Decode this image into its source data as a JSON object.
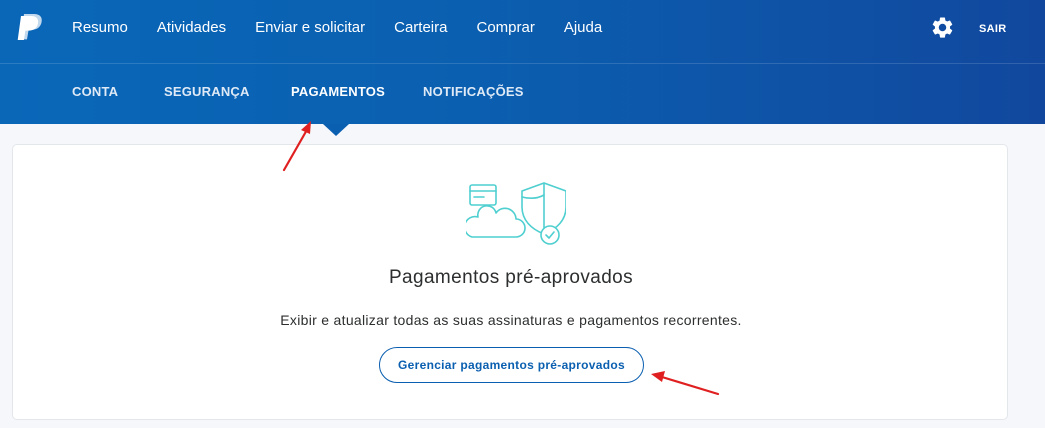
{
  "colors": {
    "header_start": "#0a67b8",
    "header_end": "#11489e",
    "accent": "#0b5fb0",
    "illustration": "#4fcfd0",
    "annotation": "#e02020"
  },
  "topnav": {
    "logo": "paypal-logo-icon",
    "links": [
      "Resumo",
      "Atividades",
      "Enviar e solicitar",
      "Carteira",
      "Comprar",
      "Ajuda"
    ],
    "settings_icon": "gear-icon",
    "logout": "SAIR"
  },
  "subnav": {
    "tabs": [
      "CONTA",
      "SEGURANÇA",
      "PAGAMENTOS",
      "NOTIFICAÇÕES"
    ],
    "active_tab": "PAGAMENTOS"
  },
  "card": {
    "icon": "card-cloud-shield-icon",
    "title": "Pagamentos pré-aprovados",
    "description": "Exibir e atualizar todas as suas assinaturas e pagamentos recorrentes.",
    "button_label": "Gerenciar pagamentos pré-aprovados"
  }
}
